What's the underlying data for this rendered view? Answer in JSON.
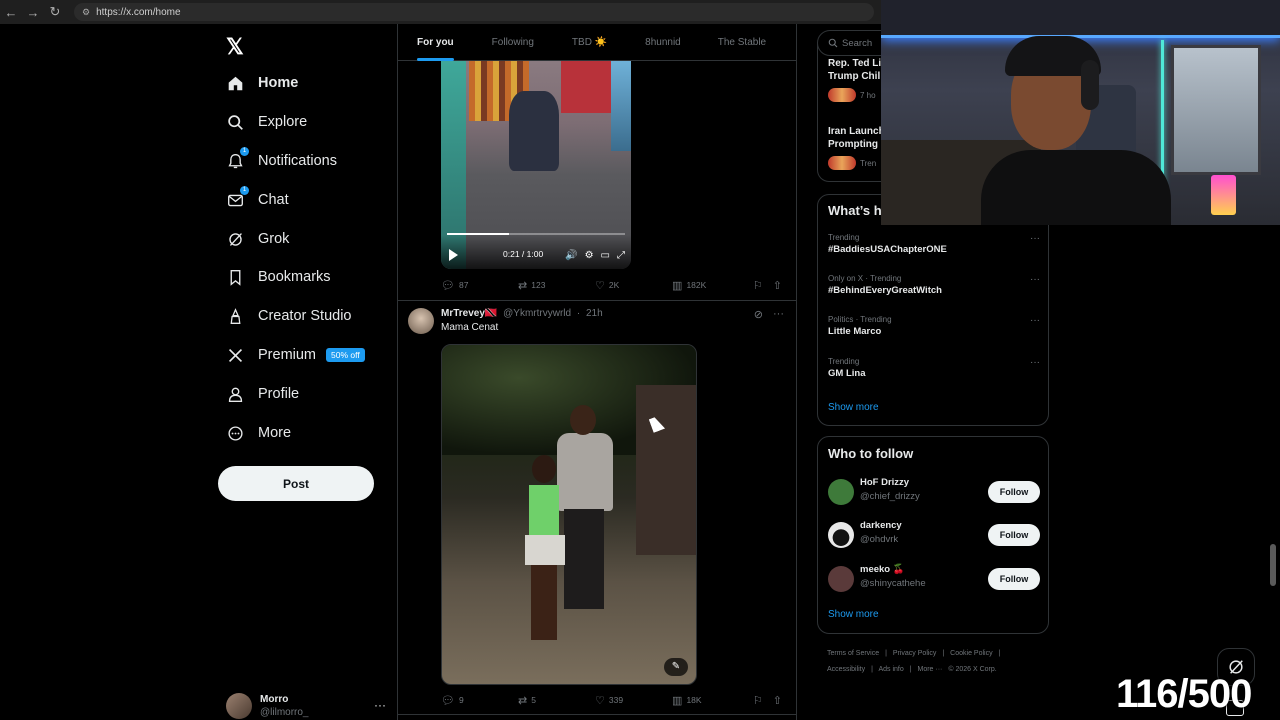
{
  "browser": {
    "url": "https://x.com/home"
  },
  "nav": {
    "items": [
      {
        "label": "Home",
        "icon": "home-icon"
      },
      {
        "label": "Explore",
        "icon": "search-icon"
      },
      {
        "label": "Notifications",
        "icon": "bell-icon"
      },
      {
        "label": "Chat",
        "icon": "mail-icon"
      },
      {
        "label": "Grok",
        "icon": "grok-icon"
      },
      {
        "label": "Bookmarks",
        "icon": "bookmark-icon"
      },
      {
        "label": "Creator Studio",
        "icon": "creator-icon"
      },
      {
        "label": "Premium",
        "icon": "x-logo-icon"
      },
      {
        "label": "Profile",
        "icon": "person-icon"
      },
      {
        "label": "More",
        "icon": "more-circle-icon"
      }
    ],
    "notifications_badge": "1",
    "chat_badge": "1",
    "premium_badge": "50% off",
    "post_label": "Post"
  },
  "account": {
    "display_name": "Morro",
    "handle": "@lilmorro_",
    "more": "···"
  },
  "tabs": [
    "For you",
    "Following",
    "TBD ☀️",
    "8hunnid",
    "The Stable"
  ],
  "video": {
    "time": "0:21 / 1:00",
    "progress": 0.35
  },
  "tweet1_actions": {
    "replies": "87",
    "reposts": "123",
    "likes": "2K",
    "views": "182K"
  },
  "tweet2": {
    "display_name": "MrTrevey🇹🇹",
    "handle": "@Ykmrtrvywrld",
    "time": "21h",
    "text": "Mama Cenat",
    "replies": "9",
    "reposts": "5",
    "likes": "339",
    "views": "18K"
  },
  "search": {
    "placeholder": "Search"
  },
  "news": [
    {
      "title": "Rep. Ted Li",
      "title2": "Trump Chil",
      "meta": "7 ho"
    },
    {
      "title": "Iran Launch",
      "title2": "Prompting",
      "meta": "Tren"
    }
  ],
  "trends": {
    "title": "What’s h",
    "items": [
      {
        "context": "Trending",
        "name": "#BaddiesUSAChapterONE"
      },
      {
        "context": "Only on X · Trending",
        "name": "#BehindEveryGreatWitch"
      },
      {
        "context": "Politics · Trending",
        "name": "Little Marco"
      },
      {
        "context": "Trending",
        "name": "GM Lina"
      }
    ],
    "show_more": "Show more"
  },
  "who_to_follow": {
    "title": "Who to follow",
    "users": [
      {
        "name": "HoF Drizzy",
        "handle": "@chief_drizzy",
        "button": "Follow",
        "color": "#3e7a3a"
      },
      {
        "name": "darkency",
        "handle": "@ohdvrk",
        "button": "Follow",
        "color": "#e8e8e8"
      },
      {
        "name": "meeko 🍒",
        "handle": "@shinycathehe",
        "button": "Follow",
        "color": "#5a3a3a"
      }
    ],
    "show_more": "Show more"
  },
  "footer": {
    "links": [
      "Terms of Service",
      "|",
      "Privacy Policy",
      "|",
      "Cookie Policy",
      "|"
    ],
    "links2": [
      "Accessibility",
      "|",
      "Ads info",
      "|",
      "More ···",
      "© 2026 X Corp."
    ]
  },
  "overlay": {
    "counter": "116/500"
  },
  "colors": {
    "accent": "#1d9bf0",
    "background": "#000000",
    "border": "#2f3336",
    "muted": "#71767b"
  }
}
